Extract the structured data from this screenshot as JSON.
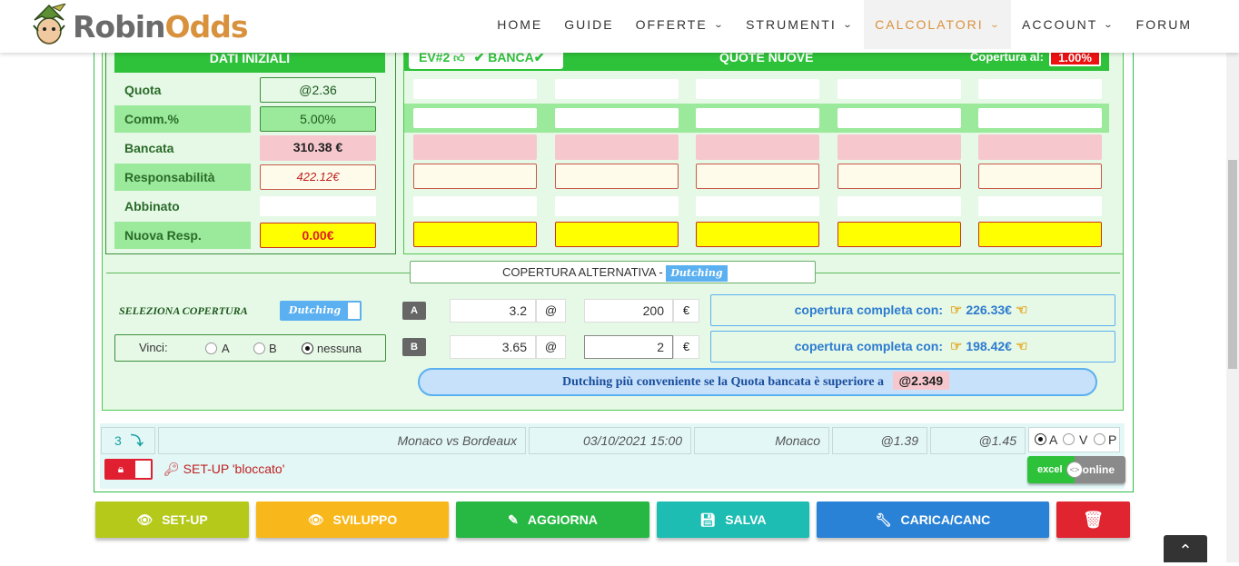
{
  "brand": {
    "part1": "Robin",
    "part2": "Odds"
  },
  "nav": [
    {
      "label": "HOME",
      "dropdown": false
    },
    {
      "label": "GUIDE",
      "dropdown": false
    },
    {
      "label": "OFFERTE",
      "dropdown": true
    },
    {
      "label": "STRUMENTI",
      "dropdown": true
    },
    {
      "label": "CALCOLATORI",
      "dropdown": true,
      "active": true
    },
    {
      "label": "ACCOUNT",
      "dropdown": true
    },
    {
      "label": "FORUM",
      "dropdown": false
    }
  ],
  "dati": {
    "header": "DATI INIZIALI",
    "quota_label": "Quota",
    "quota_value": "@2.36",
    "comm_label": "Comm.%",
    "comm_value": "5.00%",
    "bancata_label": "Bancata",
    "bancata_value": "310.38 €",
    "resp_label": "Responsabilità",
    "resp_value": "422.12€",
    "abbinato_label": "Abbinato",
    "abbinato_value": "",
    "nuova_label": "Nuova Resp.",
    "nuova_value": "0.00€"
  },
  "quote": {
    "ev_tab": "EV#2",
    "banca_label": "BANCA",
    "title": "QUOTE NUOVE",
    "copertura_label": "Copertura al:",
    "copertura_value": "1.00%"
  },
  "alternativa": {
    "title": "COPERTURA ALTERNATIVA -",
    "badge": "Dutching",
    "select_label": "SELEZIONA COPERTURA",
    "toggle_label": "Dutching",
    "vinci_label": "Vinci:",
    "options": [
      "A",
      "B",
      "nessuna"
    ],
    "selected": "nessuna"
  },
  "rows": [
    {
      "badge": "A",
      "quota": "3.2",
      "at": "@",
      "stake": "200",
      "currency": "€",
      "coverage_text": "copertura completa con:",
      "coverage_value": "226.33€"
    },
    {
      "badge": "B",
      "quota": "3.65",
      "at": "@",
      "stake": "2",
      "currency": "€",
      "coverage_text": "copertura completa con:",
      "coverage_value": "198.42€"
    }
  ],
  "dutch_note": {
    "text": "Dutching più conveniente se la Quota bancata è superiore a",
    "value": "@2.349"
  },
  "event": {
    "num": "3",
    "match": "Monaco vs Bordeaux",
    "date": "03/10/2021 15:00",
    "pick": "Monaco",
    "odd1": "@1.39",
    "odd2": "@1.45",
    "avp": [
      "A",
      "V",
      "P"
    ],
    "avp_selected": "A"
  },
  "setup_status": "SET-UP 'bloccato'",
  "excel_toggle": {
    "left": "excel",
    "right": "online"
  },
  "buttons": [
    {
      "label": "SET-UP",
      "color": "#b5c91b"
    },
    {
      "label": "SVILUPPO",
      "color": "#f8b81c"
    },
    {
      "label": "AGGIORNA",
      "color": "#27b843"
    },
    {
      "label": "SALVA",
      "color": "#1ebdb3"
    },
    {
      "label": "CARICA/CANC",
      "color": "#2a82d6"
    },
    {
      "label": "",
      "color": "#e02430"
    }
  ],
  "colors": {
    "accent": "#d8913c",
    "green": "#2ec23a",
    "blue": "#5ab0f0"
  }
}
